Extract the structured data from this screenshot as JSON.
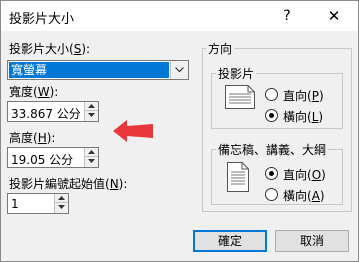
{
  "window": {
    "title": "投影片大小",
    "help_glyph": "?",
    "close_glyph": "✕"
  },
  "slide_size": {
    "label": "投影片大小(",
    "accel": "S",
    "label_end": "):",
    "selected": "寬螢幕"
  },
  "width": {
    "label": "寬度(",
    "accel": "W",
    "label_end": "):",
    "value": "33.867 公分"
  },
  "height": {
    "label": "高度(",
    "accel": "H",
    "label_end": "):",
    "value": "19.05 公分"
  },
  "numbering": {
    "label": "投影片編號起始值(",
    "accel": "N",
    "label_end": "):",
    "value": "1"
  },
  "orientation": {
    "title": "方向",
    "slides": {
      "title": "投影片",
      "portrait_label": "直向(",
      "portrait_accel": "P",
      "portrait_end": ")",
      "landscape_label": "橫向(",
      "landscape_accel": "L",
      "landscape_end": ")",
      "selected": "landscape"
    },
    "notes": {
      "title": "備忘稿、講義、大綱",
      "portrait_label": "直向(",
      "portrait_accel": "O",
      "portrait_end": ")",
      "landscape_label": "橫向(",
      "landscape_accel": "A",
      "landscape_end": ")",
      "selected": "portrait"
    }
  },
  "buttons": {
    "ok": "確定",
    "cancel": "取消"
  },
  "colors": {
    "selection": "#0078d7",
    "arrow": "#e8373a"
  }
}
